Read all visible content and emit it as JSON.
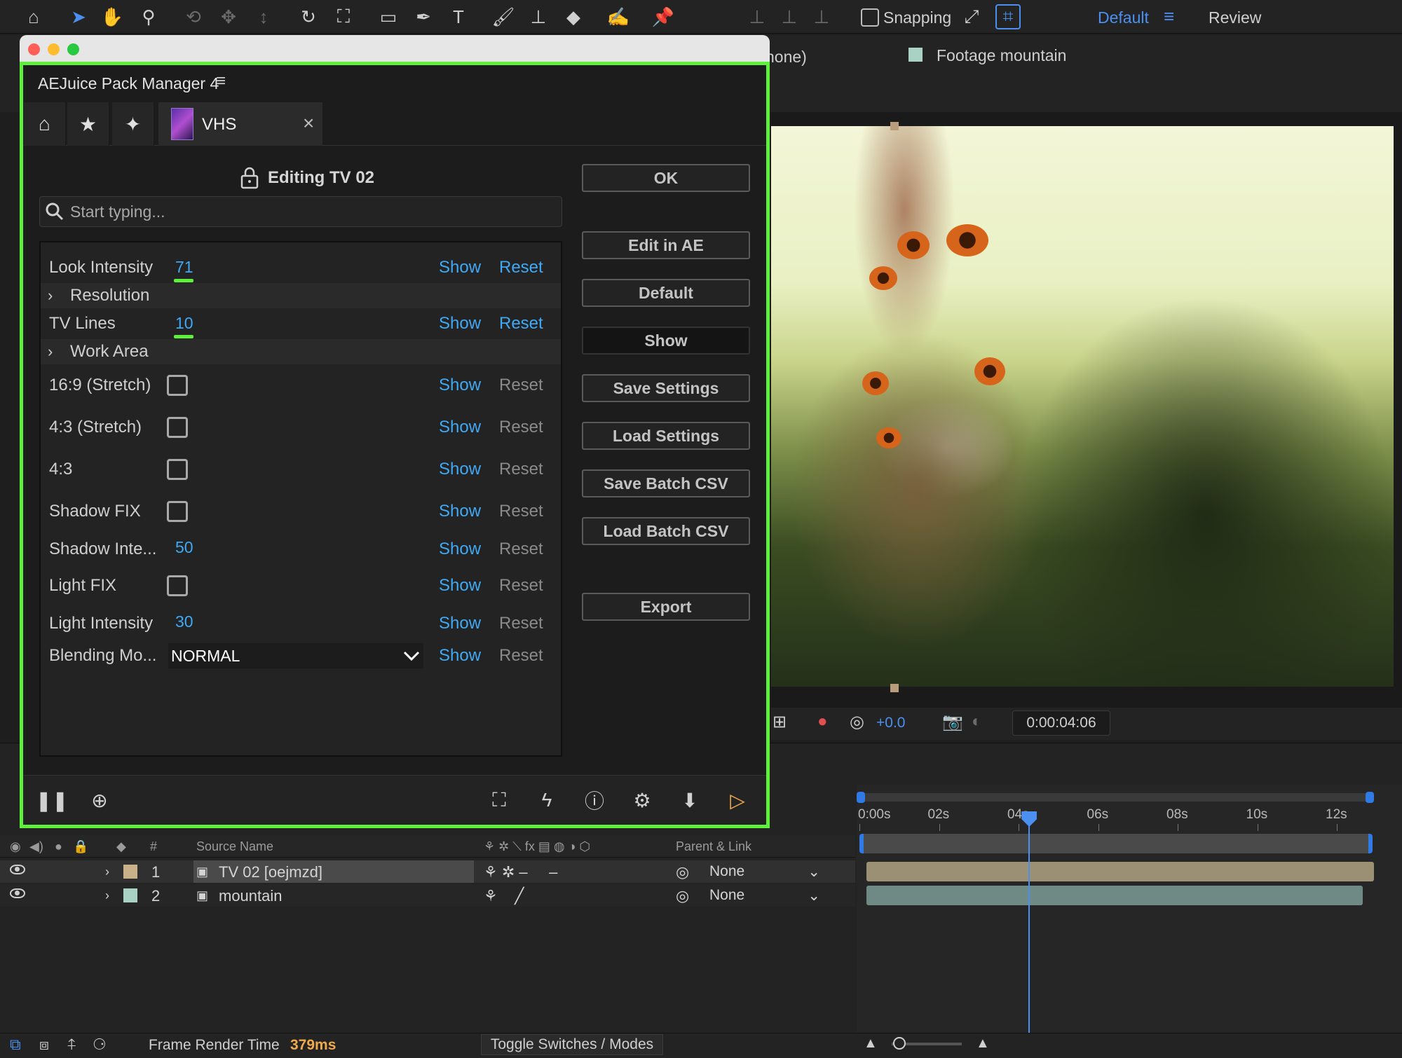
{
  "toolbar": {
    "tools": [
      "home-icon",
      "selection-icon",
      "hand-icon",
      "zoom-icon",
      "orbit-icon",
      "pan-icon",
      "dolly-icon",
      "rotate-icon",
      "pan-behind-icon",
      "rectangle-icon",
      "pen-icon",
      "type-icon",
      "brush-icon",
      "clone-stamp-icon",
      "eraser-icon",
      "roto-brush-icon",
      "puppet-pin-icon"
    ],
    "snapping_label": "Snapping",
    "workspace_default": "Default",
    "workspace_review": "Review"
  },
  "viewer": {
    "comp_label": "none)",
    "footage_label": "Footage mountain",
    "exposure": "+0.0",
    "timecode": "0:00:04:06"
  },
  "panel": {
    "title": "AEJuice Pack Manager 4",
    "tab_label": "VHS",
    "editing_title": "Editing TV 02",
    "search_placeholder": "Start typing...",
    "show_label": "Show",
    "reset_label": "Reset",
    "params": [
      {
        "label": "Look Intensity",
        "value": "71"
      },
      {
        "label": "Resolution"
      },
      {
        "label": "TV Lines",
        "value": "10"
      },
      {
        "label": "Work Area"
      },
      {
        "label": "16:9 (Stretch)",
        "checked": false
      },
      {
        "label": "4:3 (Stretch)",
        "checked": false
      },
      {
        "label": "4:3",
        "checked": false
      },
      {
        "label": "Shadow FIX",
        "checked": false
      },
      {
        "label": "Shadow Inte...",
        "value": "50"
      },
      {
        "label": "Light FIX",
        "checked": false
      },
      {
        "label": "Light Intensity",
        "value": "30"
      },
      {
        "label": "Blending Mo...",
        "value": "NORMAL"
      }
    ],
    "buttons": [
      "OK",
      "Edit in AE",
      "Default",
      "Show",
      "Save Settings",
      "Load Settings",
      "Save Batch CSV",
      "Load Batch CSV",
      "Export"
    ]
  },
  "timeline": {
    "headers": {
      "num": "#",
      "source": "Source Name",
      "parent": "Parent & Link"
    },
    "ticks": [
      "0:00s",
      "02s",
      "04s",
      "06s",
      "08s",
      "10s",
      "12s"
    ],
    "layers": [
      {
        "num": "1",
        "name": "TV 02 [oejmzd]",
        "parent": "None",
        "color": "#c9b18a"
      },
      {
        "num": "2",
        "name": "mountain",
        "parent": "None",
        "color": "#a9d2c4"
      }
    ],
    "playhead_seconds": 4.25
  },
  "status": {
    "frame_render_label": "Frame Render Time",
    "frame_render_value": "379ms",
    "toggle_label": "Toggle Switches / Modes"
  },
  "colors": {
    "accent": "#4b8ff0",
    "highlight_border": "#5ef03a",
    "link_blue": "#3fa9f5",
    "render_time": "#f0a94b"
  }
}
